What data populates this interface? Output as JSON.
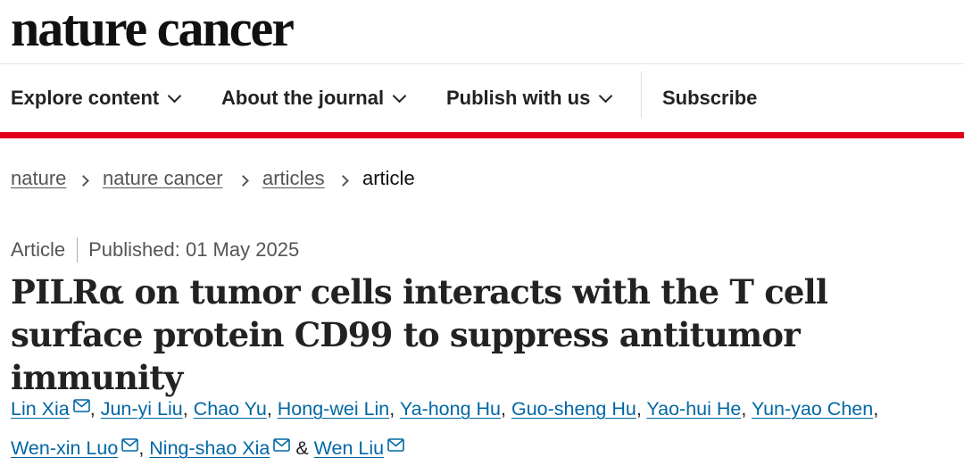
{
  "site": {
    "logo": "nature cancer"
  },
  "nav": {
    "items": [
      {
        "label": "Explore content"
      },
      {
        "label": "About the journal"
      },
      {
        "label": "Publish with us"
      }
    ],
    "subscribe": "Subscribe"
  },
  "colors": {
    "accent": "#e3001b",
    "link": "#0067a5"
  },
  "breadcrumb": [
    "nature",
    "nature cancer",
    "articles",
    "article"
  ],
  "article": {
    "type": "Article",
    "published": "Published: 01 May 2025",
    "title": "PILRα on tumor cells interacts with the T cell surface protein CD99 to suppress antitumor immunity"
  },
  "authors": [
    {
      "name": "Lin Xia",
      "email": true
    },
    {
      "name": "Jun-yi Liu",
      "email": false
    },
    {
      "name": "Chao Yu",
      "email": false
    },
    {
      "name": "Hong-wei Lin",
      "email": false
    },
    {
      "name": "Ya-hong Hu",
      "email": false
    },
    {
      "name": "Guo-sheng Hu",
      "email": false
    },
    {
      "name": "Yao-hui He",
      "email": false
    },
    {
      "name": "Yun-yao Chen",
      "email": false
    },
    {
      "name": "Wen-xin Luo",
      "email": true
    },
    {
      "name": "Ning-shao Xia",
      "email": true
    },
    {
      "name": "Wen Liu",
      "email": true
    }
  ],
  "authors_joiner": {
    "comma": ",",
    "ampersand": "&"
  },
  "icons": {
    "chevron": "chevron-down-icon",
    "breadcrumb_sep": "chevron-right-icon",
    "mail": "mail-icon"
  }
}
